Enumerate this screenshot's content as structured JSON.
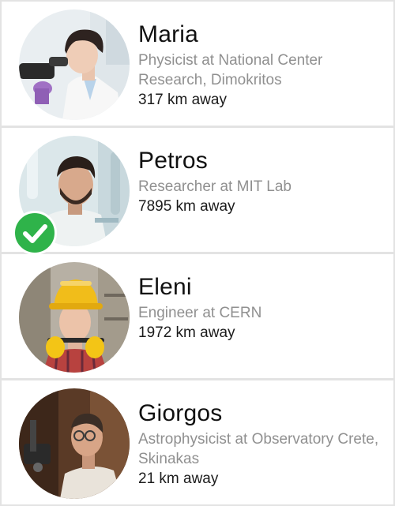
{
  "people": [
    {
      "name": "Maria",
      "role": "Physicist at National Center Research, Dimokritos",
      "distance": "317 km away",
      "avatar_icon": "scientist-microscope-photo",
      "verified": false
    },
    {
      "name": "Petros",
      "role": "Researcher at MIT Lab",
      "distance": "7895 km away",
      "avatar_icon": "researcher-lab-photo",
      "verified": true,
      "badge_icon": "checkmark-icon",
      "badge_color": "#2fb34a"
    },
    {
      "name": "Eleni",
      "role": "Engineer at CERN",
      "distance": "1972 km away",
      "avatar_icon": "engineer-hardhat-photo",
      "verified": false
    },
    {
      "name": "Giorgos",
      "role": "Astrophysicist at Observatory Crete, Skinakas",
      "distance": "21 km away",
      "avatar_icon": "astrophysicist-telescope-photo",
      "verified": false
    }
  ]
}
